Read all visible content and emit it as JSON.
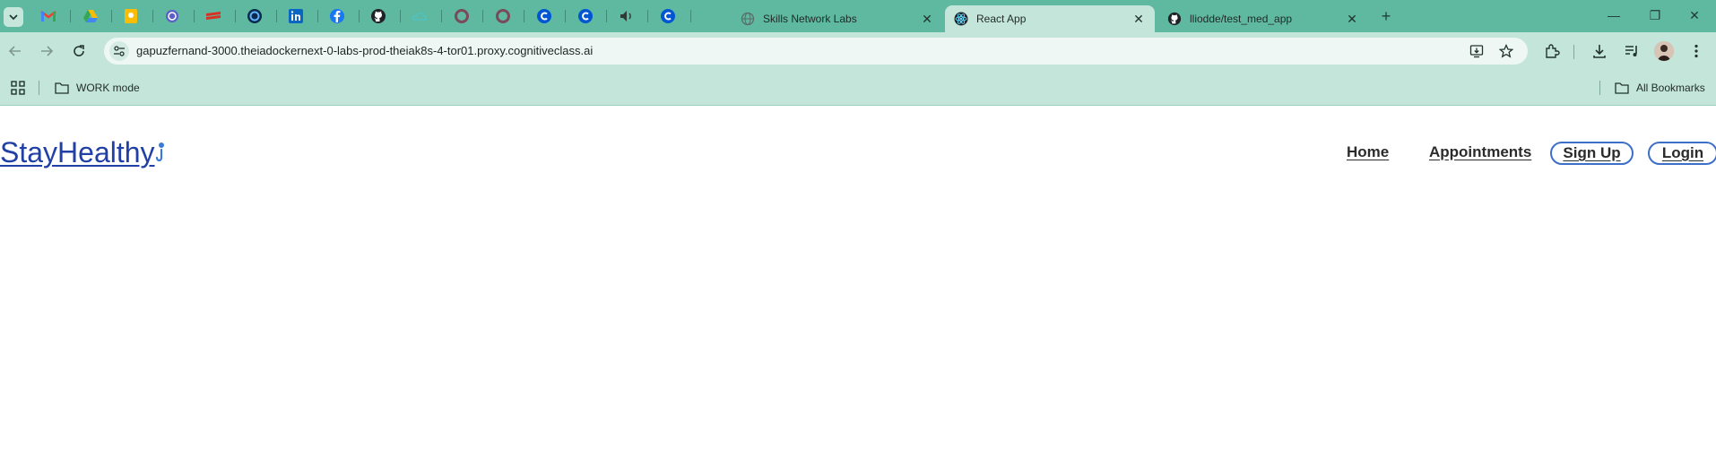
{
  "browser": {
    "tabs": [
      {
        "title": "Skills Network Labs",
        "active": false
      },
      {
        "title": "React App",
        "active": true
      },
      {
        "title": "lliodde/test_med_app",
        "active": false
      }
    ],
    "pinned_tabs": [
      "gmail-icon",
      "drive-icon",
      "keep-icon",
      "app-icon",
      "bookmark-app-icon",
      "circle-app-icon",
      "linkedin-icon",
      "facebook-icon",
      "github-icon",
      "cloud-app-icon",
      "ring-app-icon",
      "ring-app-icon-2",
      "coursera-icon",
      "coursera-icon-2",
      "audio-icon",
      "coursera-icon-3"
    ],
    "url": "gapuzfernand-3000.theiadockernext-0-labs-prod-theiak8s-4-tor01.proxy.cognitiveclass.ai",
    "bookmarks": {
      "left_folder": "WORK mode",
      "right_folder": "All Bookmarks"
    },
    "colors": {
      "frame": "#5fb8a0",
      "toolbar": "#c4e5da"
    }
  },
  "app": {
    "brand": "StayHealthy",
    "nav": {
      "home": "Home",
      "appointments": "Appointments",
      "signup": "Sign Up",
      "login": "Login"
    },
    "colors": {
      "brand": "#2040a8",
      "pill_border": "#3d6fc9"
    }
  }
}
